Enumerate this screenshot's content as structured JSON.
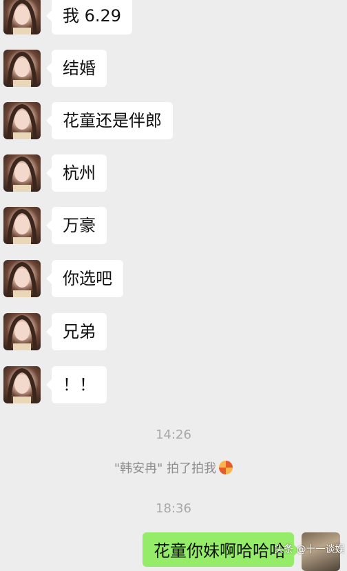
{
  "messages": [
    {
      "text": "我 6.29"
    },
    {
      "text": "结婚"
    },
    {
      "text": "花童还是伴郎"
    },
    {
      "text": "杭州"
    },
    {
      "text": "万豪"
    },
    {
      "text": "你选吧"
    },
    {
      "text": "兄弟"
    },
    {
      "text": "！！"
    }
  ],
  "timestamps": {
    "first": "14:26",
    "second": "18:36"
  },
  "system_message": {
    "text": "\"韩安冉\" 拍了拍我",
    "emoji": "pat-emoji-icon"
  },
  "outgoing": {
    "text": "花童你妹啊哈哈哈"
  },
  "watermark": {
    "text": "头条 @十一谈娱"
  },
  "colors": {
    "background": "#ededed",
    "incoming_bubble": "#ffffff",
    "outgoing_bubble": "#95ec69"
  }
}
